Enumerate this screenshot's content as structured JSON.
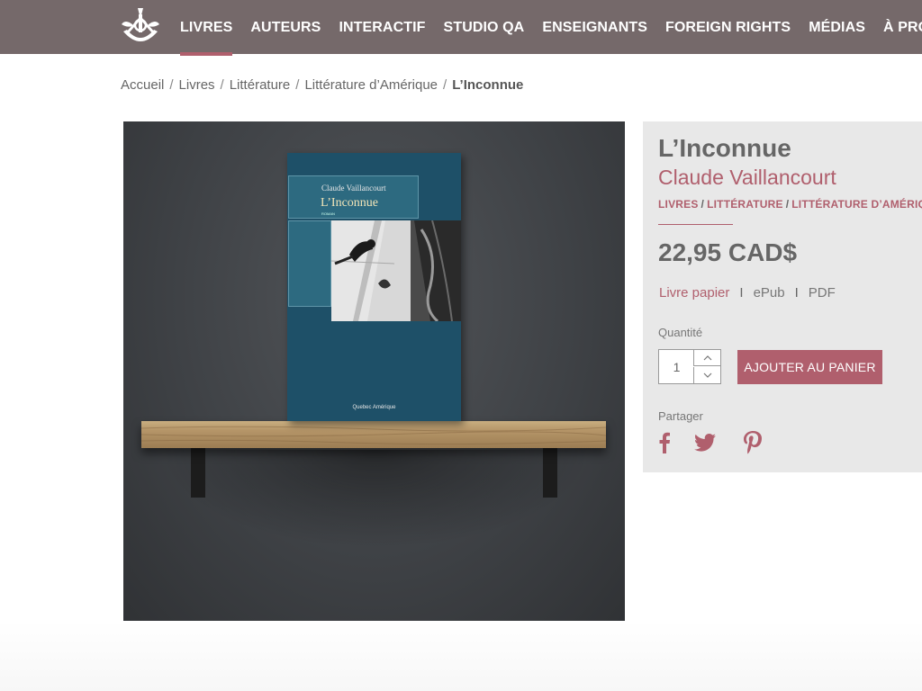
{
  "header": {
    "logo_icon": "sextant-logo-icon",
    "nav": [
      {
        "label": "LIVRES",
        "active": true
      },
      {
        "label": "AUTEURS"
      },
      {
        "label": "INTERACTIF"
      },
      {
        "label": "STUDIO QA"
      },
      {
        "label": "ENSEIGNANTS"
      },
      {
        "label": "FOREIGN RIGHTS"
      },
      {
        "label": "MÉDIAS"
      },
      {
        "label": "À PROPOS"
      }
    ]
  },
  "breadcrumb": {
    "items": [
      "Accueil",
      "Livres",
      "Littérature",
      "Littérature d’Amérique"
    ],
    "current": "L’Inconnue",
    "separator": "/"
  },
  "cover": {
    "author": "Claude Vaillancourt",
    "title": "L’Inconnue",
    "genre": "ROMAN",
    "publisher": "Quebec Amérique"
  },
  "product": {
    "title": "L’Inconnue",
    "author": "Claude Vaillancourt",
    "categories": [
      "LIVRES",
      "LITTÉRATURE",
      "LITTÉRATURE D’AMÉRIQUE"
    ],
    "category_separator": "/",
    "price": "22,95 CAD$",
    "formats": [
      "Livre papier",
      "ePub",
      "PDF"
    ],
    "format_separator": "I",
    "quantity_label": "Quantité",
    "quantity_value": "1",
    "add_to_cart_label": "AJOUTER AU PANIER",
    "share_label": "Partager",
    "share_icons": [
      "facebook-icon",
      "twitter-icon",
      "pinterest-icon"
    ]
  },
  "colors": {
    "header_bg": "#75696a",
    "accent": "#b05f6d",
    "panel_bg": "#e8e8e8",
    "text": "#666666",
    "book_blue": "#1e5068"
  }
}
